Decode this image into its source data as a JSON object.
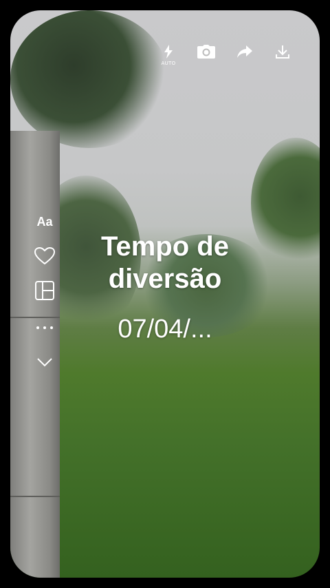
{
  "toolbar": {
    "flash_mode_label": "AUTO",
    "icons": [
      "flash-icon",
      "camera-icon",
      "share-icon",
      "download-icon"
    ]
  },
  "sidebar": {
    "text_button_label": "Aa",
    "icons": [
      "text-style-icon",
      "heart-icon",
      "layout-icon",
      "more-icon",
      "chevron-down-icon"
    ]
  },
  "overlay": {
    "title": "Tempo de diversão",
    "date": "07/04/..."
  },
  "colors": {
    "background": "#000000",
    "overlay_text": "#ffffff"
  }
}
